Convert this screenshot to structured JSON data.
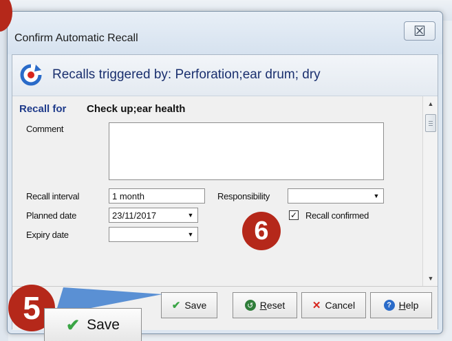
{
  "window": {
    "title": "Confirm Automatic Recall",
    "close_glyph": "☒"
  },
  "header": {
    "icon": "recall-refresh-icon",
    "title": "Recalls triggered by: Perforation;ear drum; dry"
  },
  "form": {
    "recall_for_label": "Recall for",
    "recall_for_value": "Check up;ear health",
    "comment_label": "Comment",
    "comment_value": "",
    "recall_interval_label": "Recall interval",
    "recall_interval_value": "1 month",
    "responsibility_label": "Responsibility",
    "responsibility_value": "",
    "planned_date_label": "Planned date",
    "planned_date_value": "23/11/2017",
    "expiry_date_label": "Expiry date",
    "expiry_date_value": "",
    "recall_confirmed_label": "Recall confirmed",
    "recall_confirmed_checked": true
  },
  "buttons": {
    "save": "Save",
    "reset_prefix": "R",
    "reset_rest": "eset",
    "cancel": "Cancel",
    "help_prefix": "H",
    "help_rest": "elp"
  },
  "callouts": {
    "step5": "5",
    "step6": "6",
    "zoom_save_label": "Save"
  },
  "colors": {
    "callout": "#b5281a",
    "title_blue": "#1a2f6e",
    "label_blue": "#1e3a8a"
  }
}
